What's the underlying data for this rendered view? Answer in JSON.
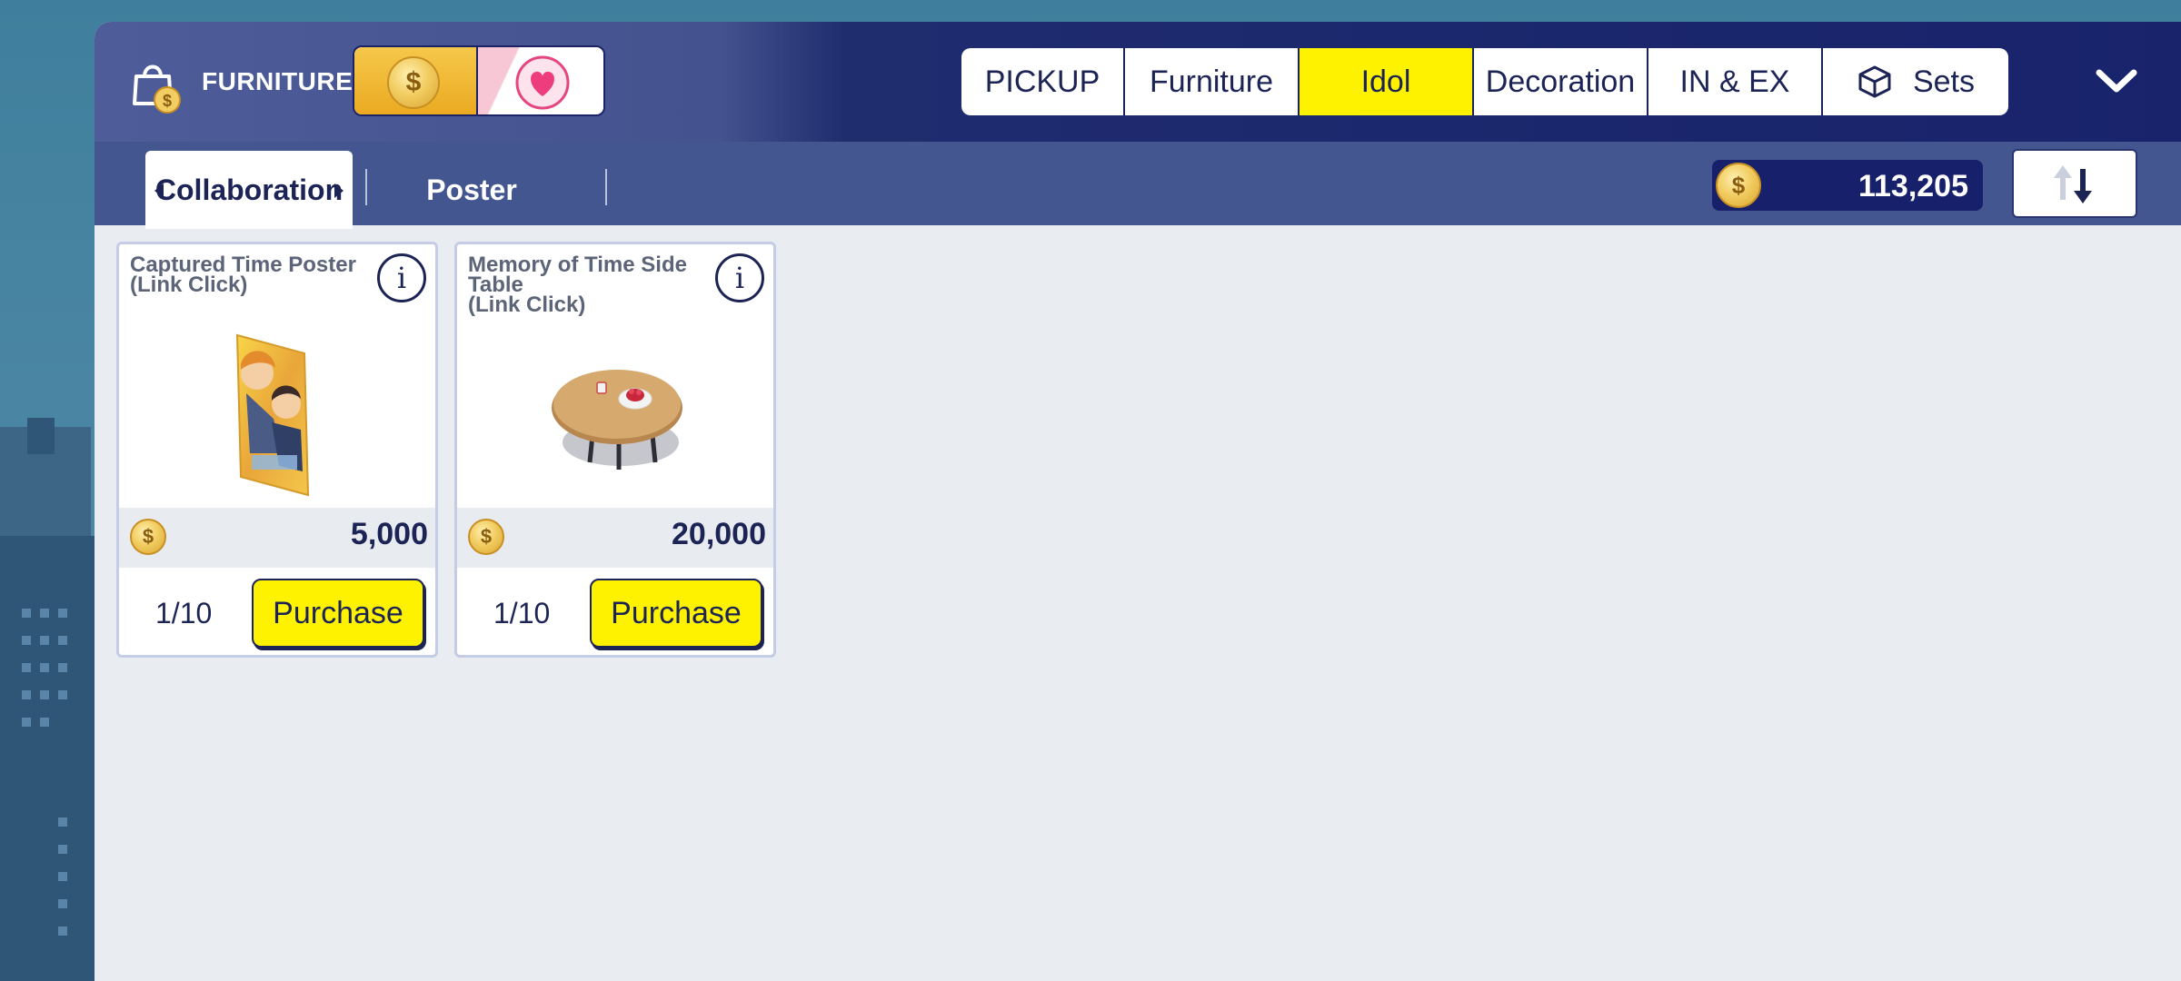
{
  "shop": {
    "title": "FURNITURE",
    "currency_toggle": [
      "coin",
      "heart"
    ]
  },
  "category_tabs": [
    {
      "label": "PICKUP",
      "active": false
    },
    {
      "label": "Furniture",
      "active": false
    },
    {
      "label": "Idol",
      "active": true
    },
    {
      "label": "Decoration",
      "active": false
    },
    {
      "label": "IN & EX",
      "active": false
    },
    {
      "label": "Sets",
      "active": false,
      "icon": "box-icon"
    }
  ],
  "sub_tabs": [
    {
      "label": "Collaboration",
      "active": true
    },
    {
      "label": "Poster",
      "active": false
    }
  ],
  "balance": {
    "value": "113,205",
    "icon": "coin-icon"
  },
  "sort_button": {
    "icon": "sort-arrows-icon"
  },
  "items": [
    {
      "title": "Captured Time Poster\n(Link Click)",
      "price": "5,000",
      "stock": "1/10",
      "purchase_label": "Purchase",
      "image": "poster-image"
    },
    {
      "title": "Memory of Time Side\nTable\n(Link Click)",
      "price": "20,000",
      "stock": "1/10",
      "purchase_label": "Purchase",
      "image": "side-table-image"
    }
  ],
  "colors": {
    "accent_yellow": "#fff200",
    "navy": "#1c2456",
    "subbar": "#43568f"
  }
}
